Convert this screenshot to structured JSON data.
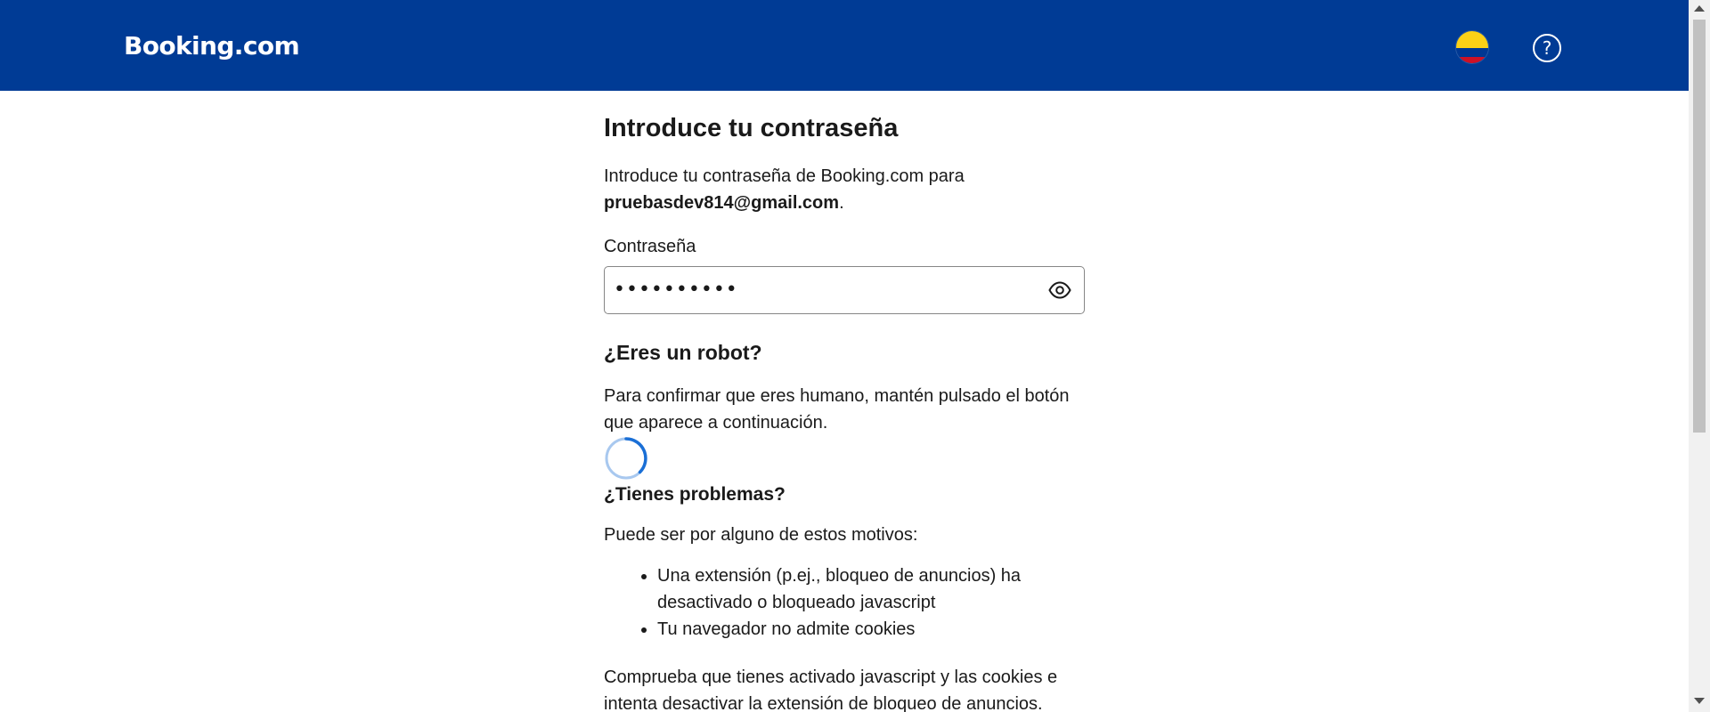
{
  "header": {
    "logo": "Booking.com",
    "flag_icon": "colombia-flag-icon",
    "help_icon": "help-icon",
    "help_symbol": "?",
    "colors": {
      "background": "#003b95",
      "text": "#ffffff"
    }
  },
  "main": {
    "title": "Introduce tu contraseña",
    "intro_text": "Introduce tu contraseña de Booking.com para",
    "email": "pruebasdev814@gmail.com",
    "email_suffix": ".",
    "password_label": "Contraseña",
    "password_value": "••••••••••",
    "show_password_icon": "eye-icon",
    "robot_title": "¿Eres un robot?",
    "robot_desc": "Para confirmar que eres humano, mantén pulsado el botón que aparece a continuación.",
    "spinner_icon": "loading-spinner-icon",
    "problems_title": "¿Tienes problemas?",
    "problems_desc": "Puede ser por alguno de estos motivos:",
    "reasons": [
      "Una extensión (p.ej., bloqueo de anuncios) ha desactivado o bloqueado javascript",
      "Tu navegador no admite cookies"
    ],
    "check_text": "Comprueba que tienes activado javascript y las cookies e intenta desactivar la extensión de bloqueo de anuncios."
  }
}
